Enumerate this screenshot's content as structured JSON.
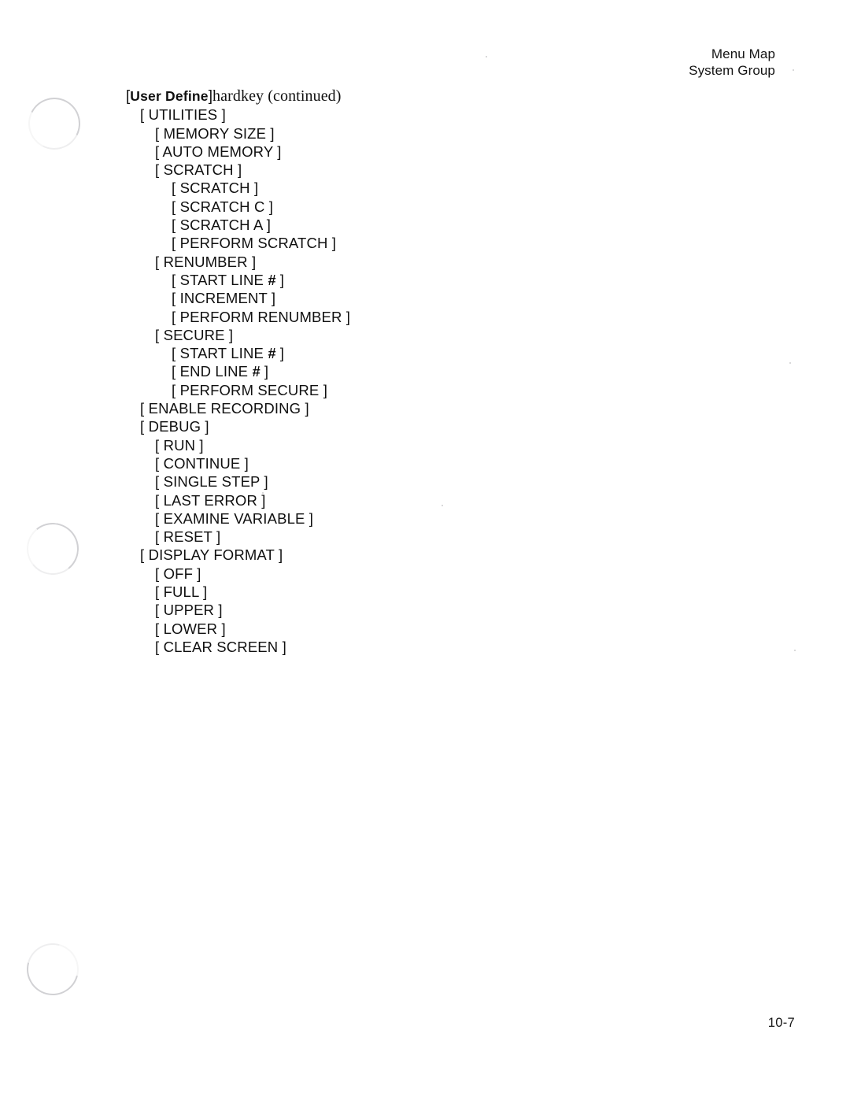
{
  "running_head": {
    "line1": "Menu Map",
    "line2": "System Group"
  },
  "title_line": {
    "open_bracket": "[",
    "key_name": "User Define",
    "close_bracket": "]",
    "description": "hardkey (continued)"
  },
  "menu_tree": [
    {
      "level": 1,
      "label": "[ UTILITIES ]"
    },
    {
      "level": 2,
      "label": "[ MEMORY SIZE ]"
    },
    {
      "level": 2,
      "label": "[ AUTO MEMORY ]"
    },
    {
      "level": 2,
      "label": "[ SCRATCH ]"
    },
    {
      "level": 3,
      "label": "[ SCRATCH ]"
    },
    {
      "level": 3,
      "label": "[ SCRATCH C ]"
    },
    {
      "level": 3,
      "label": "[ SCRATCH A ]"
    },
    {
      "level": 3,
      "label": "[ PERFORM SCRATCH ]"
    },
    {
      "level": 2,
      "label": "[ RENUMBER ]"
    },
    {
      "level": 3,
      "label": "[ START LINE # ]"
    },
    {
      "level": 3,
      "label": "[ INCREMENT ]"
    },
    {
      "level": 3,
      "label": "[ PERFORM RENUMBER ]"
    },
    {
      "level": 2,
      "label": "[ SECURE ]"
    },
    {
      "level": 3,
      "label": "[ START LINE # ]"
    },
    {
      "level": 3,
      "label": "[ END LINE # ]"
    },
    {
      "level": 3,
      "label": "[ PERFORM SECURE ]"
    },
    {
      "level": 1,
      "label": "[ ENABLE RECORDING ]"
    },
    {
      "level": 1,
      "label": "[ DEBUG ]"
    },
    {
      "level": 2,
      "label": "[ RUN ]"
    },
    {
      "level": 2,
      "label": "[ CONTINUE ]"
    },
    {
      "level": 2,
      "label": "[ SINGLE STEP ]"
    },
    {
      "level": 2,
      "label": "[ LAST ERROR ]"
    },
    {
      "level": 2,
      "label": "[ EXAMINE VARIABLE ]"
    },
    {
      "level": 2,
      "label": "[ RESET ]"
    },
    {
      "level": 1,
      "label": "[ DISPLAY FORMAT ]"
    },
    {
      "level": 2,
      "label": "[ OFF ]"
    },
    {
      "level": 2,
      "label": "[ FULL ]"
    },
    {
      "level": 2,
      "label": "[ UPPER ]"
    },
    {
      "level": 2,
      "label": "[ LOWER ]"
    },
    {
      "level": 2,
      "label": "[ CLEAR SCREEN ]"
    }
  ],
  "folio": "10-7",
  "colors": {
    "page_background": "#ffffff",
    "text": "#101010"
  }
}
